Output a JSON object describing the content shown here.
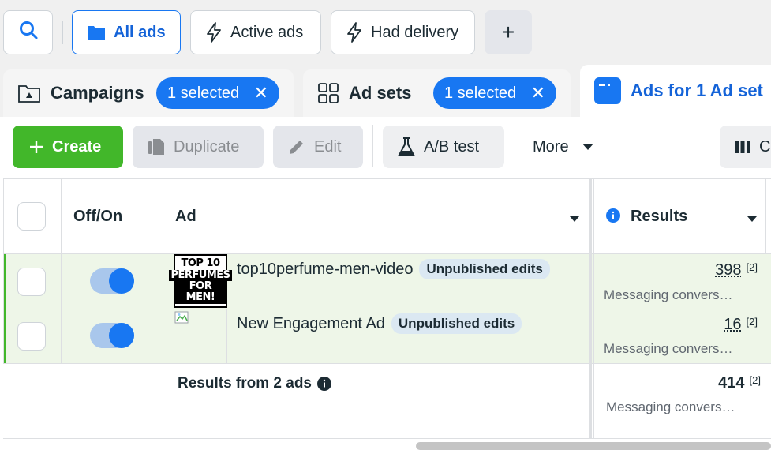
{
  "filters": {
    "all_ads": "All ads",
    "active_ads": "Active ads",
    "had_delivery": "Had delivery",
    "add": "+"
  },
  "tabs": {
    "campaigns": {
      "label": "Campaigns",
      "pill": "1 selected"
    },
    "ad_sets": {
      "label": "Ad sets",
      "pill": "1 selected"
    },
    "ads": {
      "label": "Ads for 1 Ad set"
    }
  },
  "toolbar": {
    "create": "Create",
    "duplicate": "Duplicate",
    "edit": "Edit",
    "ab_test": "A/B test",
    "more": "More",
    "columns": "C"
  },
  "table": {
    "headers": {
      "off_on": "Off/On",
      "ad": "Ad",
      "results": "Results"
    },
    "rows": [
      {
        "name": "top10perfume-men-video",
        "badge": "Unpublished edits",
        "result": "398",
        "footnote": "[2]",
        "result_type": "Messaging convers…",
        "on": true,
        "thumb_lines": [
          "TOP 10",
          "PERFUMES",
          "FOR MEN!"
        ]
      },
      {
        "name": "New Engagement Ad",
        "badge": "Unpublished edits",
        "result": "16",
        "footnote": "[2]",
        "result_type": "Messaging convers…",
        "on": true
      }
    ],
    "summary": {
      "label": "Results from 2 ads",
      "result": "414",
      "footnote": "[2]",
      "result_type": "Messaging convers…"
    }
  },
  "colors": {
    "accent": "#1877f2",
    "create_green": "#42b72a",
    "row_highlight": "#eef6e8"
  }
}
